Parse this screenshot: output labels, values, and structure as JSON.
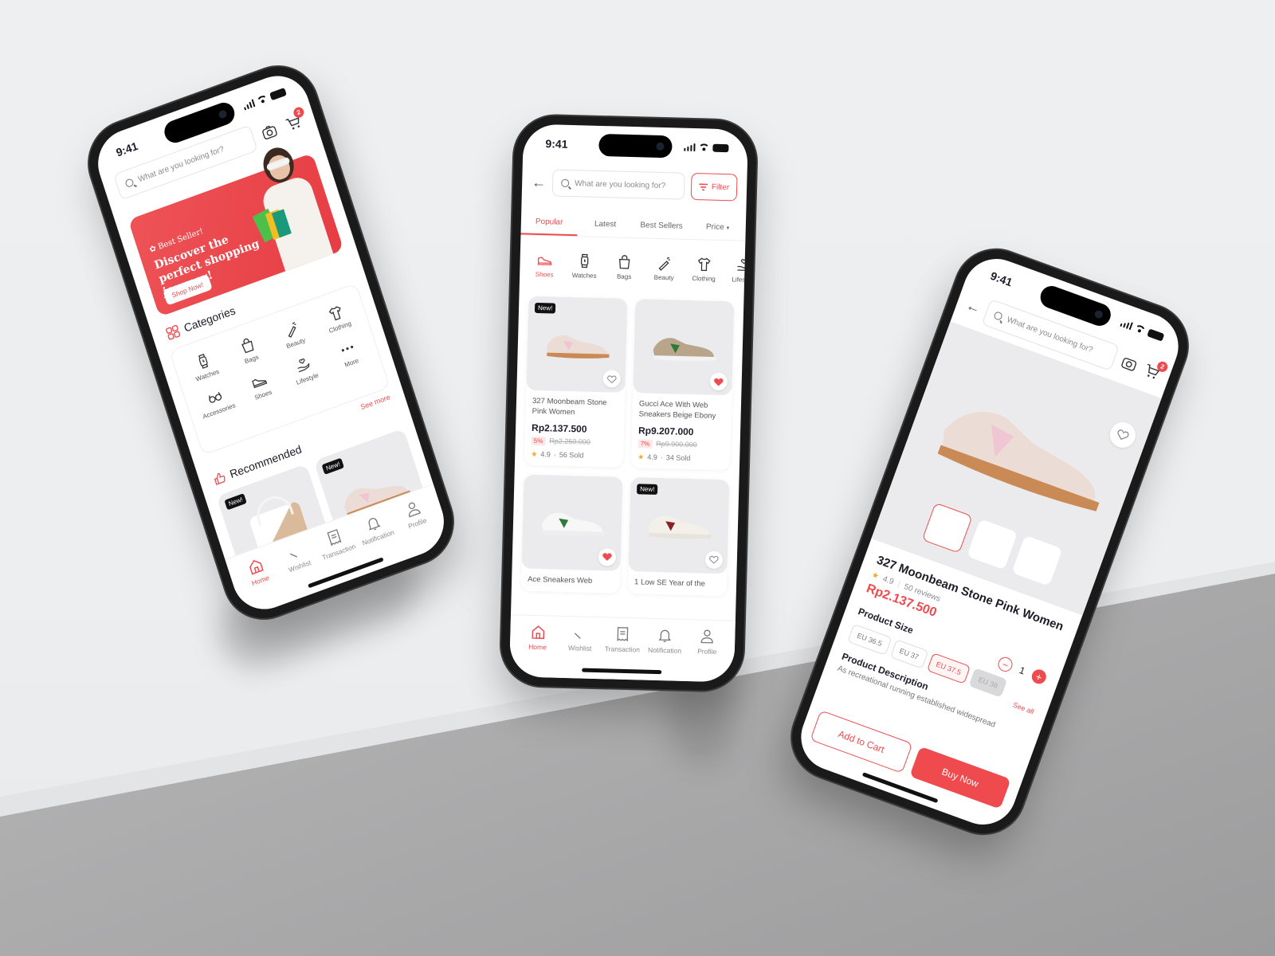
{
  "status_time": "9:41",
  "search_placeholder": "What are you looking for?",
  "cart_count": "2",
  "colors": {
    "accent": "#ef4b4f",
    "dark": "#1c1c28",
    "muted": "#8a8a93",
    "card_bg": "#ebebed"
  },
  "home_screen": {
    "banner": {
      "badge": "Best Seller!",
      "headline": "Discover the perfect shopping journey!",
      "cta": "Shop Now!"
    },
    "categories_title": "Categories",
    "categories": [
      {
        "label": "Watches",
        "icon": "watch-icon"
      },
      {
        "label": "Bags",
        "icon": "bag-icon"
      },
      {
        "label": "Beauty",
        "icon": "magic-wand-icon"
      },
      {
        "label": "Clothing",
        "icon": "tshirt-icon"
      },
      {
        "label": "Accessories",
        "icon": "glasses-icon"
      },
      {
        "label": "Shoes",
        "icon": "shoe-icon"
      },
      {
        "label": "Lifestyle",
        "icon": "hand-heart-icon"
      },
      {
        "label": "More",
        "icon": "more-dots-icon"
      }
    ],
    "see_more": "See more",
    "recommended_title": "Recommended",
    "recommended": [
      {
        "tag": "New!",
        "favorited": true,
        "product": "bag"
      },
      {
        "tag": "New!",
        "favorited": false,
        "product": "sneaker"
      }
    ]
  },
  "listing_screen": {
    "filter_label": "Filter",
    "sort_tabs": [
      {
        "label": "Popular",
        "active": true
      },
      {
        "label": "Latest",
        "active": false
      },
      {
        "label": "Best Sellers",
        "active": false
      },
      {
        "label": "Price",
        "active": false,
        "has_dropdown": true
      }
    ],
    "categories": [
      {
        "label": "Shoes",
        "active": true
      },
      {
        "label": "Watches",
        "active": false
      },
      {
        "label": "Bags",
        "active": false
      },
      {
        "label": "Beauty",
        "active": false
      },
      {
        "label": "Clothing",
        "active": false
      },
      {
        "label": "Lifestyle",
        "active": false
      }
    ],
    "products": [
      {
        "name": "327 Moonbeam Stone Pink Women",
        "price": "Rp2.137.500",
        "discount": "5%",
        "original_price": "Rp2.250.000",
        "rating": "4.9",
        "sold": "56 Sold",
        "tag": "New!",
        "favorited": false
      },
      {
        "name": "Gucci Ace With Web Sneakers Beige Ebony",
        "price": "Rp9.207.000",
        "discount": "7%",
        "original_price": "Rp9.900.000",
        "rating": "4.9",
        "sold": "34 Sold",
        "tag": "",
        "favorited": true
      },
      {
        "name": "Ace Sneakers Web",
        "tag": "",
        "favorited": true
      },
      {
        "name": "1 Low SE Year of the",
        "tag": "New!",
        "favorited": false
      }
    ]
  },
  "detail_screen": {
    "product_name": "327 Moonbeam Stone Pink Women",
    "rating": "4.9",
    "reviews": "50 reviews",
    "price": "Rp2.137.500",
    "size_title": "Product Size",
    "sizes": [
      {
        "label": "EU 36.5",
        "state": "default"
      },
      {
        "label": "EU 37",
        "state": "default"
      },
      {
        "label": "EU 37.5",
        "state": "selected"
      },
      {
        "label": "EU 38",
        "state": "disabled"
      }
    ],
    "see_all": "See all",
    "quantity": "1",
    "description_title": "Product Description",
    "description": "As recreational running established widespread",
    "add_to_cart": "Add to Cart",
    "buy_now": "Buy Now"
  },
  "nav": [
    {
      "label": "Home",
      "icon": "home-icon",
      "active": true
    },
    {
      "label": "Wishlist",
      "icon": "heart-icon",
      "active": false
    },
    {
      "label": "Transaction",
      "icon": "receipt-icon",
      "active": false
    },
    {
      "label": "Notification",
      "icon": "bell-icon",
      "active": false
    },
    {
      "label": "Profile",
      "icon": "user-icon",
      "active": false
    }
  ]
}
